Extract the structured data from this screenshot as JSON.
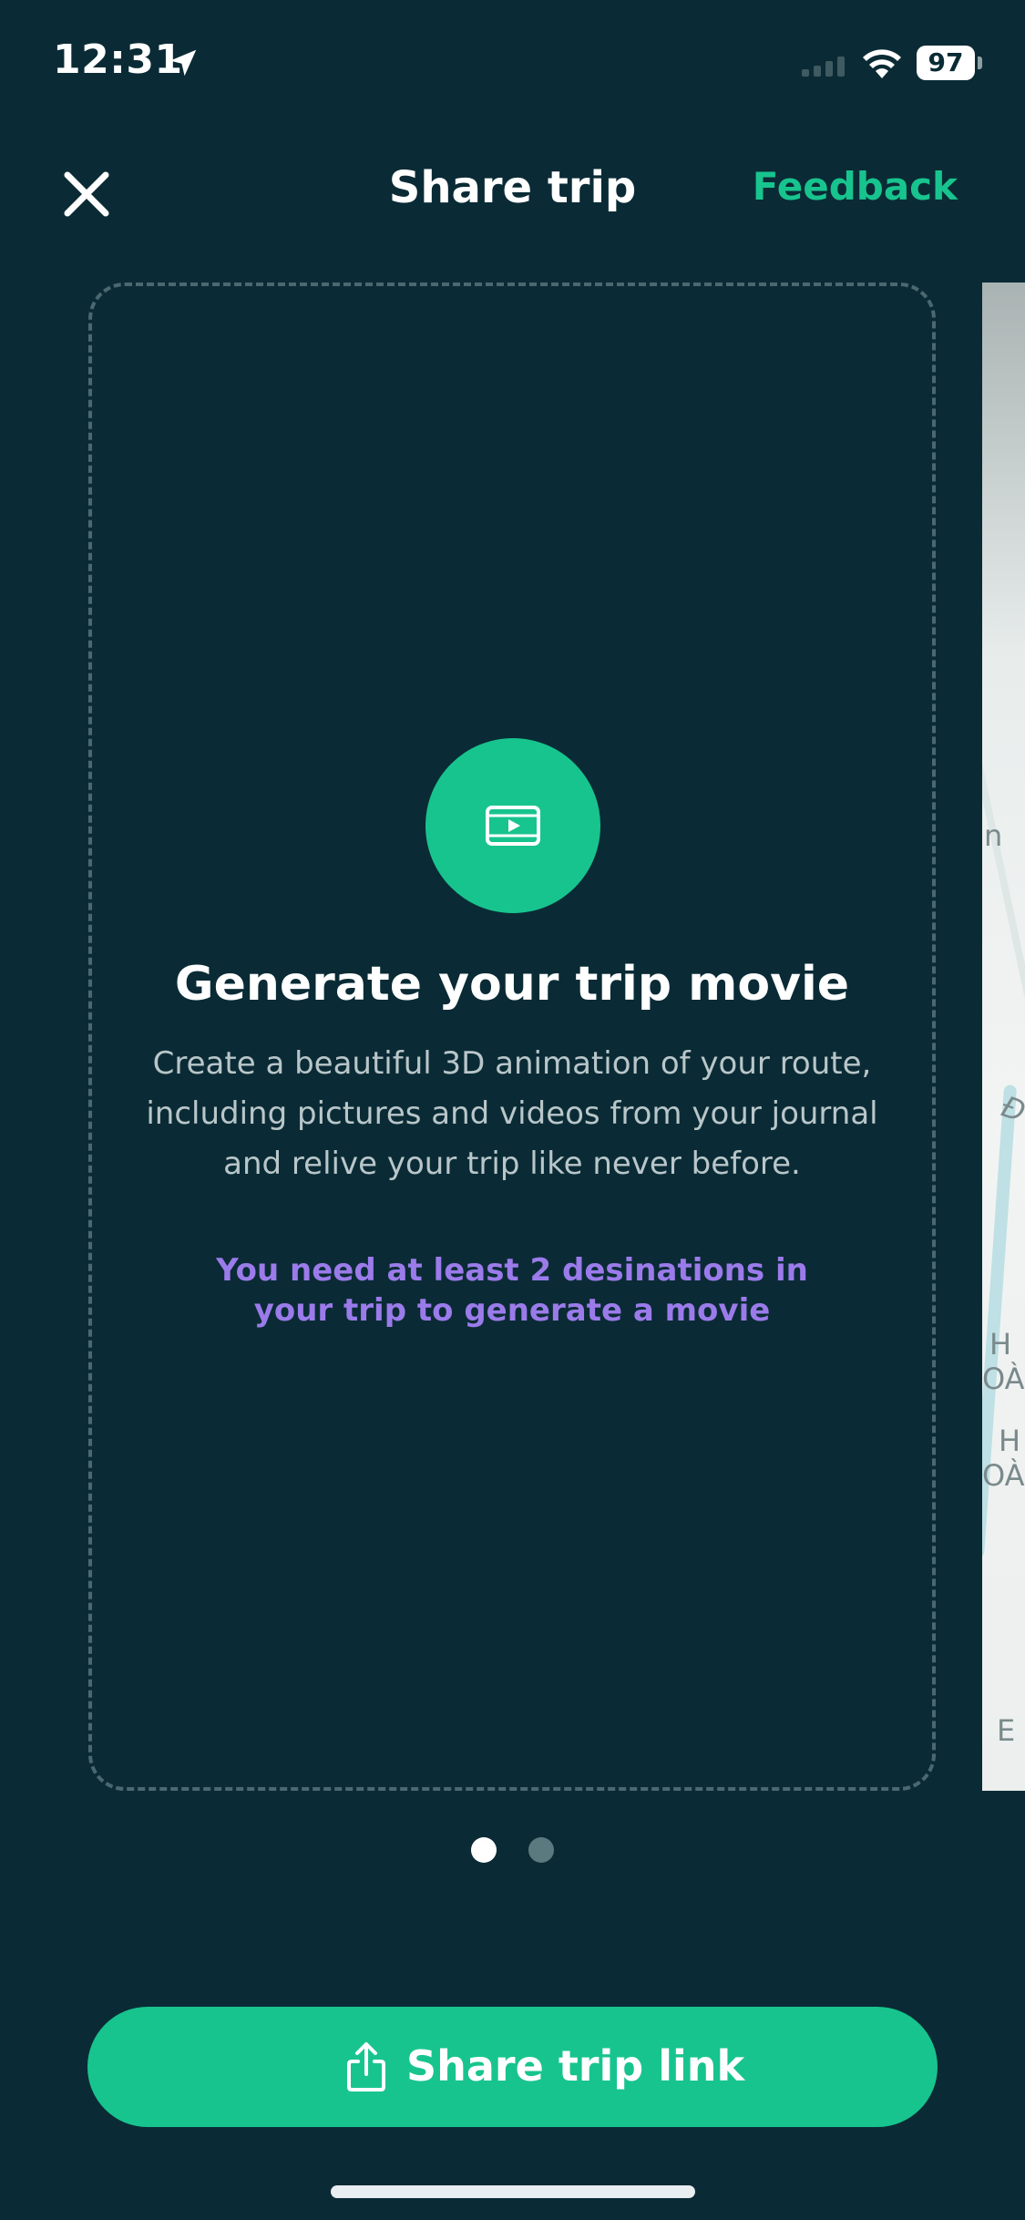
{
  "status_bar": {
    "time": "12:31",
    "battery": "97"
  },
  "header": {
    "title": "Share trip",
    "feedback_label": "Feedback",
    "close_icon": "close-icon"
  },
  "card": {
    "icon": "film-play-icon",
    "title": "Generate your trip movie",
    "description": "Create a beautiful 3D animation of your route, including pictures and videos from your journal and relive your trip like never before.",
    "warning": "You need at least 2 desinations in your trip to generate a movie"
  },
  "peek_map_labels": [
    "n",
    "Đ",
    "H",
    "OÀ",
    "H",
    "OÀ",
    "E"
  ],
  "pagination": {
    "count": 2,
    "active_index": 0
  },
  "primary_action": {
    "label": "Share trip link",
    "icon": "share-icon"
  },
  "colors": {
    "background": "#0a2b35",
    "accent": "#18c48e",
    "warning": "#9b7bea"
  }
}
